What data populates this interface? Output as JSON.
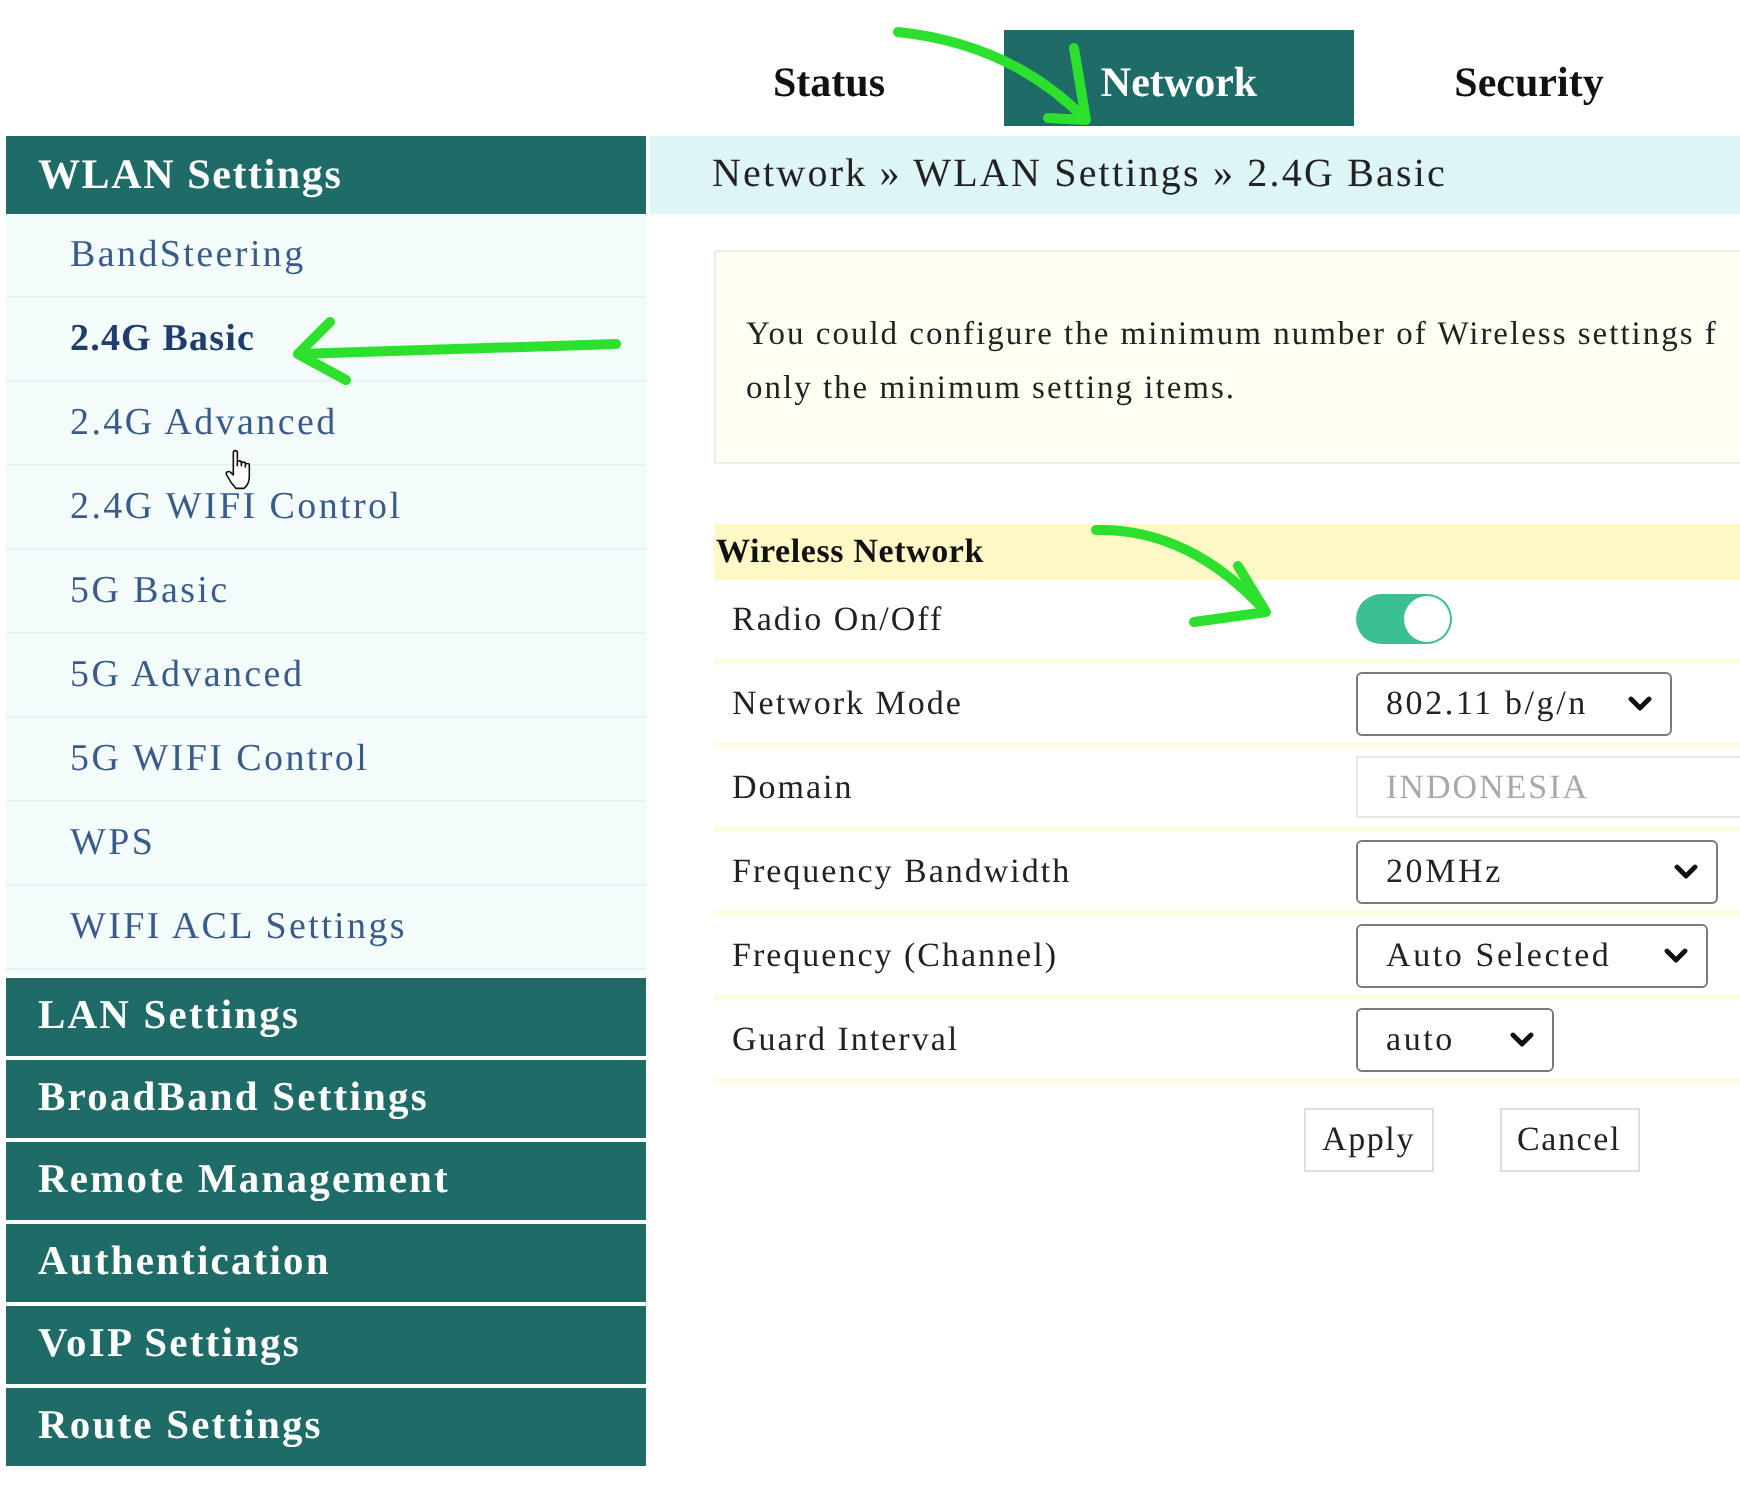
{
  "top_tabs": [
    {
      "label": "Status",
      "selected": false
    },
    {
      "label": "Network",
      "selected": true
    },
    {
      "label": "Security",
      "selected": false
    }
  ],
  "sidebar": {
    "header": "WLAN Settings",
    "items": [
      {
        "label": "BandSteering",
        "selected": false
      },
      {
        "label": "2.4G Basic",
        "selected": true
      },
      {
        "label": "2.4G Advanced",
        "selected": false
      },
      {
        "label": "2.4G WIFI Control",
        "selected": false
      },
      {
        "label": "5G Basic",
        "selected": false
      },
      {
        "label": "5G Advanced",
        "selected": false
      },
      {
        "label": "5G WIFI Control",
        "selected": false
      },
      {
        "label": "WPS",
        "selected": false
      },
      {
        "label": "WIFI ACL Settings",
        "selected": false
      }
    ],
    "groups": [
      "LAN Settings",
      "BroadBand Settings",
      "Remote Management",
      "Authentication",
      "VoIP Settings",
      "Route Settings"
    ]
  },
  "breadcrumb": "Network » WLAN Settings » 2.4G Basic",
  "description": {
    "lines": [
      "You could configure the minimum number of Wireless settings f",
      "only the minimum setting items."
    ]
  },
  "section": {
    "title": "Wireless Network",
    "rows": [
      {
        "label": "Radio On/Off",
        "kind": "toggle",
        "on": true,
        "disabled": false
      },
      {
        "label": "Network Mode",
        "kind": "select",
        "value": "802.11 b/g/n",
        "disabled": false
      },
      {
        "label": "Domain",
        "kind": "text",
        "value": "INDONESIA",
        "disabled": true
      },
      {
        "label": "Frequency Bandwidth",
        "kind": "select",
        "value": "20MHz",
        "disabled": false
      },
      {
        "label": "Frequency (Channel)",
        "kind": "select",
        "value": "Auto Selected",
        "disabled": false
      },
      {
        "label": "Guard Interval",
        "kind": "select",
        "value": "auto",
        "disabled": false
      }
    ]
  },
  "buttons": [
    "Apply",
    "Cancel"
  ]
}
